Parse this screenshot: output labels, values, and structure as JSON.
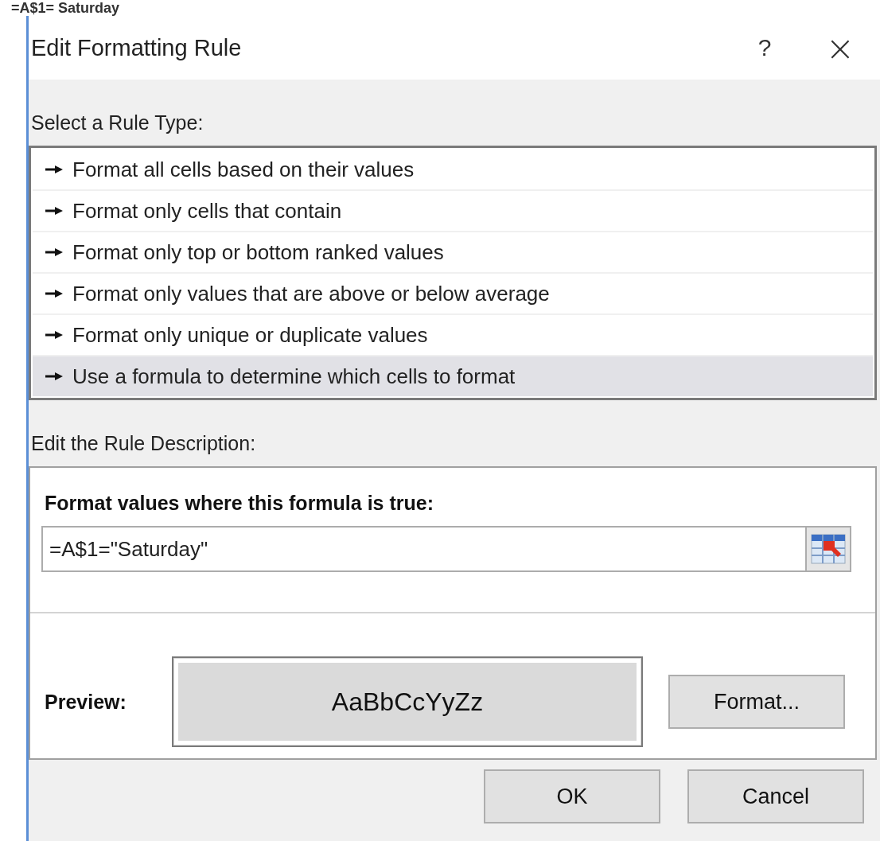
{
  "background_text": "=A$1= Saturday",
  "window": {
    "title": "Edit Formatting Rule",
    "help": "?",
    "close": "×"
  },
  "rule_type": {
    "label": "Select a Rule Type:",
    "items": [
      {
        "label": "Format all cells based on their values",
        "selected": false
      },
      {
        "label": "Format only cells that contain",
        "selected": false
      },
      {
        "label": "Format only top or bottom ranked values",
        "selected": false
      },
      {
        "label": "Format only values that are above or below average",
        "selected": false
      },
      {
        "label": "Format only unique or duplicate values",
        "selected": false
      },
      {
        "label": "Use a formula to determine which cells to format",
        "selected": true
      }
    ]
  },
  "description": {
    "label": "Edit the Rule Description:",
    "formula_label": "Format values where this formula is true:",
    "formula": "=A$1=\"Saturday\"",
    "preview_label": "Preview:",
    "preview_sample": "AaBbCcYyZz",
    "format_button": "Format..."
  },
  "buttons": [
    {
      "label": "OK"
    },
    {
      "label": "Cancel"
    }
  ]
}
